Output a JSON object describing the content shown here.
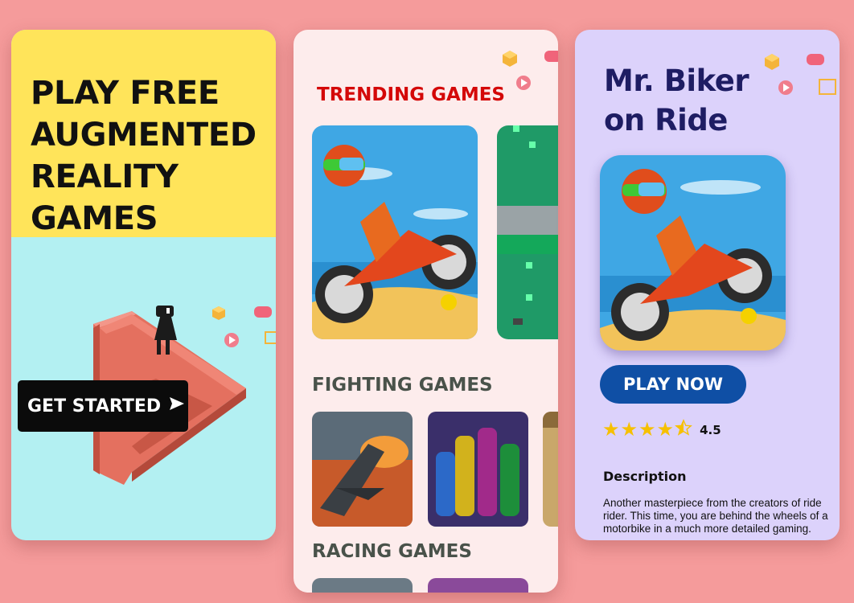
{
  "screens": {
    "onboarding": {
      "headline_lines": [
        "PLAY FREE",
        "AUGMENTED",
        "REALITY",
        "GAMES"
      ],
      "cta_label": "GET STARTED",
      "cta_icon": "send-arrow-icon"
    },
    "catalog": {
      "sections": [
        {
          "title": "TRENDING GAMES"
        },
        {
          "title": "FIGHTING GAMES"
        },
        {
          "title": "RACING GAMES"
        }
      ]
    },
    "detail": {
      "title_lines": [
        "Mr. Biker",
        "on Ride"
      ],
      "play_label": "PLAY NOW",
      "rating": 4.5,
      "rating_text": "4.5",
      "stars": "★★★★⯪",
      "description_title": "Description",
      "description": "Another masterpiece from the creators of ride rider. This time, you are behind the wheels of a motorbike in a much more detailed gaming."
    }
  },
  "decor_icons": [
    "cube-icon",
    "gamepad-icon",
    "play-icon",
    "window-icon"
  ],
  "colors": {
    "background": "#f59b9b",
    "hero_yellow": "#ffe45a",
    "hero_cyan": "#b3f0f2",
    "trending_red": "#d40808",
    "detail_title": "#1e1d63",
    "play_button": "#0f4fa5",
    "star": "#f6c000"
  }
}
